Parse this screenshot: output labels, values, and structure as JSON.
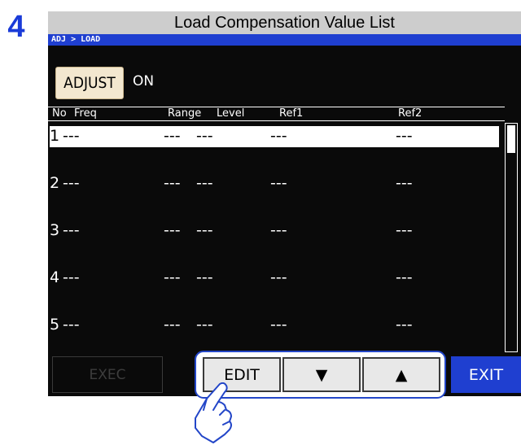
{
  "step_number": "4",
  "title": "Load Compensation Value List",
  "breadcrumb": "ADJ > LOAD",
  "adjust": {
    "button_label": "ADJUST",
    "state": "ON"
  },
  "table": {
    "headers": [
      "No",
      "Freq",
      "Range",
      "Level",
      "Ref1",
      "Ref2"
    ],
    "rows": [
      {
        "no": "1",
        "freq": "---",
        "range": "---",
        "level": "---",
        "ref1": "---",
        "ref2": "---",
        "selected": true
      },
      {
        "no": "2",
        "freq": "---",
        "range": "---",
        "level": "---",
        "ref1": "---",
        "ref2": "---"
      },
      {
        "no": "3",
        "freq": "---",
        "range": "---",
        "level": "---",
        "ref1": "---",
        "ref2": "---"
      },
      {
        "no": "4",
        "freq": "---",
        "range": "---",
        "level": "---",
        "ref1": "---",
        "ref2": "---"
      },
      {
        "no": "5",
        "freq": "---",
        "range": "---",
        "level": "---",
        "ref1": "---",
        "ref2": "---"
      }
    ]
  },
  "buttons": {
    "exec": "EXEC",
    "edit": "EDIT",
    "down": "▼",
    "up": "▲",
    "exit": "EXIT"
  },
  "colors": {
    "accent_blue": "#1f3fd0",
    "screen_bg": "#0a0a0a",
    "adjust_button": "#f3e7cf"
  },
  "icons": {
    "pointer": "pointing-hand-icon",
    "down": "down-arrow-icon",
    "up": "up-arrow-icon"
  }
}
